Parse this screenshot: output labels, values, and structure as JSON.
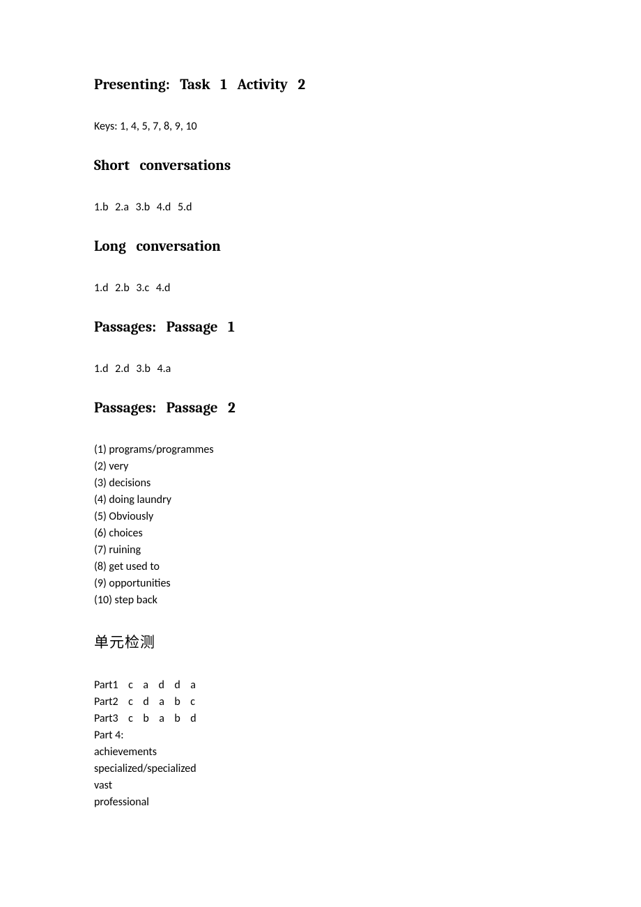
{
  "sections": {
    "presenting": {
      "heading": "Presenting: Task 1 Activity 2",
      "keys_label": "Keys: 1, 4, 5, 7, 8, 9, 10"
    },
    "short_conv": {
      "heading": "Short conversations",
      "answers": "1.b   2.a   3.b   4.d   5.d"
    },
    "long_conv": {
      "heading": "Long conversation",
      "answers": "1.d   2.b   3.c   4.d"
    },
    "passage1": {
      "heading": "Passages: Passage 1",
      "answers": "1.d   2.d   3.b   4.a"
    },
    "passage2": {
      "heading": "Passages: Passage 2",
      "items": [
        "(1) programs/programmes",
        "(2) very",
        "(3) decisions",
        "(4) doing laundry",
        "(5) Obviously",
        "(6) choices",
        "(7) ruining",
        "(8) get used to",
        "(9) opportunities",
        "(10) step back"
      ]
    },
    "unit_test": {
      "heading": "单元检测",
      "parts": [
        "Part1    c    a    d    d    a",
        "Part2    c    d    a    b    c",
        "Part3    c    b    a    b    d",
        "Part 4:",
        "achievements",
        "specialized/specialized",
        "vast",
        "professional"
      ]
    }
  }
}
